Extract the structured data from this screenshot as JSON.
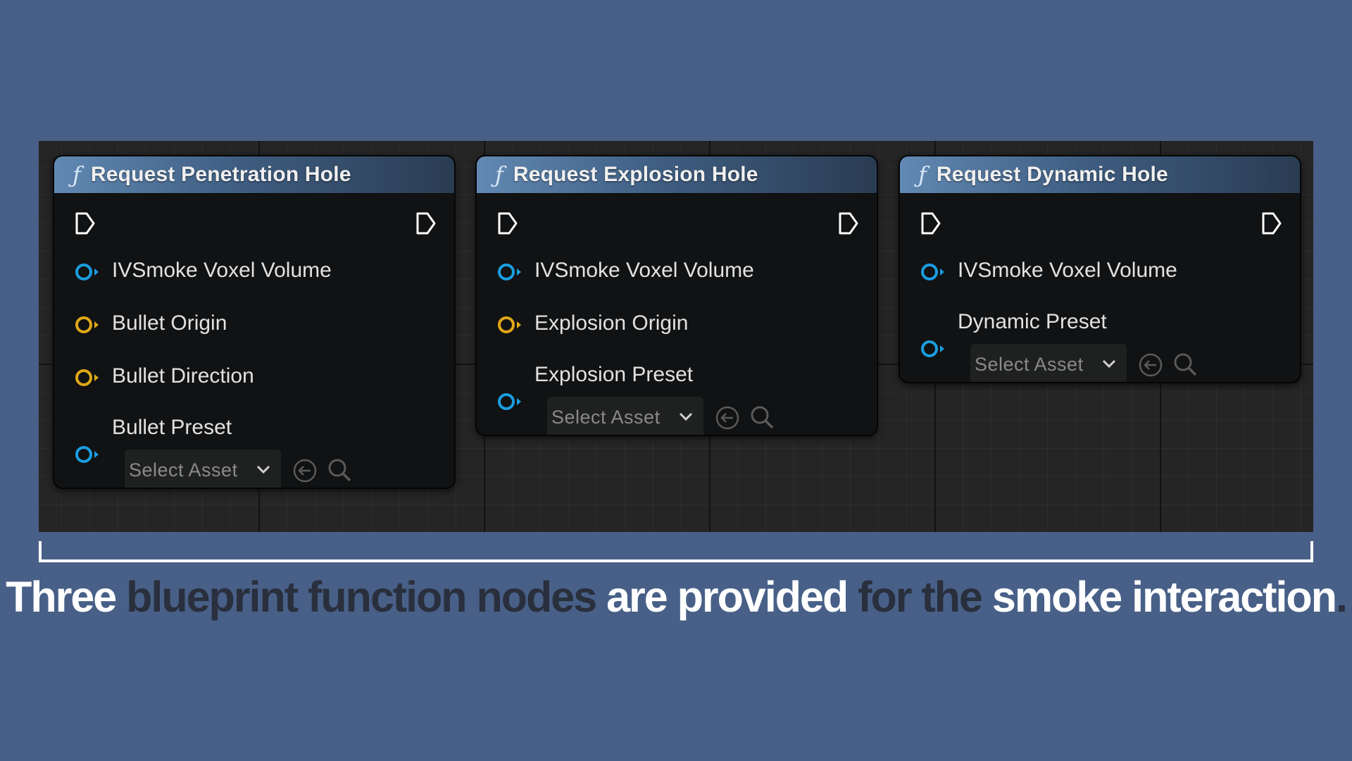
{
  "nodes": [
    {
      "title": "Request Penetration Hole",
      "pins": [
        {
          "label": "IVSmoke Voxel Volume",
          "color": "#1a9ee0"
        },
        {
          "label": "Bullet Origin",
          "color": "#e0a817"
        },
        {
          "label": "Bullet Direction",
          "color": "#e0a817"
        }
      ],
      "preset": {
        "label": "Bullet Preset",
        "value": "Select Asset",
        "color": "#1a9ee0"
      }
    },
    {
      "title": "Request Explosion Hole",
      "pins": [
        {
          "label": "IVSmoke Voxel Volume",
          "color": "#1a9ee0"
        },
        {
          "label": "Explosion Origin",
          "color": "#e0a817"
        }
      ],
      "preset": {
        "label": "Explosion Preset",
        "value": "Select Asset",
        "color": "#1a9ee0"
      }
    },
    {
      "title": "Request Dynamic Hole",
      "pins": [
        {
          "label": "IVSmoke Voxel Volume",
          "color": "#1a9ee0"
        }
      ],
      "preset": {
        "label": "Dynamic Preset",
        "value": "Select Asset",
        "color": "#1a9ee0"
      }
    }
  ],
  "icons": {
    "function": "function-icon",
    "exec": "exec-pin-icon",
    "object_pin": "object-pin-icon",
    "vector_pin": "vector-pin-icon",
    "use_selected": "use-selected-asset-icon",
    "browse": "browse-asset-icon"
  },
  "caption": {
    "part1": "Three",
    "part2": "blueprint function nodes",
    "part3": "are provided",
    "part4": "for the",
    "part5": "smoke interaction",
    "part6": "."
  },
  "colors": {
    "background": "#486087",
    "graph": "#252525",
    "object_pin": "#1a9ee0",
    "vector_pin": "#e0a817",
    "caption_light": "#ffffff",
    "caption_dark": "#2a2f3d"
  }
}
